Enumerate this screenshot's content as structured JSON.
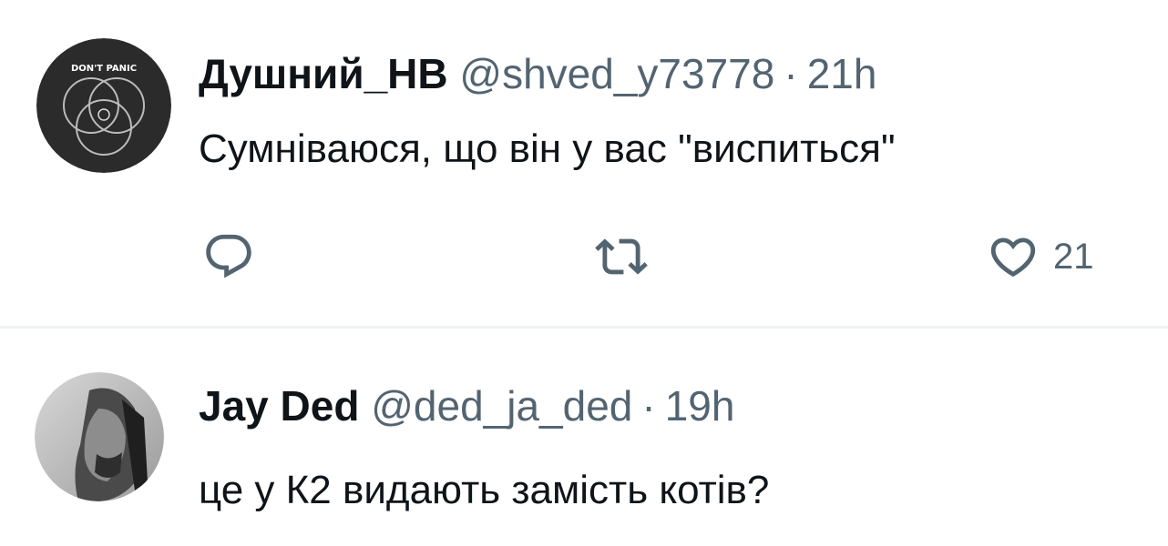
{
  "tweets": [
    {
      "author_name": "Душний_НВ",
      "handle": "@shved_y73778",
      "separator": "·",
      "time": "21h",
      "text": "Сумніваюся, що він у вас \"виспиться\"",
      "avatar_icon": "dont-panic-venn-avatar",
      "avatar_text": "DON'T PANIC",
      "actions": {
        "reply_icon": "reply-icon",
        "retweet_icon": "retweet-icon",
        "like_icon": "heart-icon",
        "like_count": "21"
      }
    },
    {
      "author_name": "Jay Ded",
      "handle": "@ded_ja_ded",
      "separator": "·",
      "time": "19h",
      "text": "це у К2 видають замість котів?",
      "avatar_icon": "portrait-photo-avatar"
    }
  ],
  "colors": {
    "primary_text": "#0f1419",
    "secondary_text": "#536471",
    "divider": "#eff3f4"
  }
}
